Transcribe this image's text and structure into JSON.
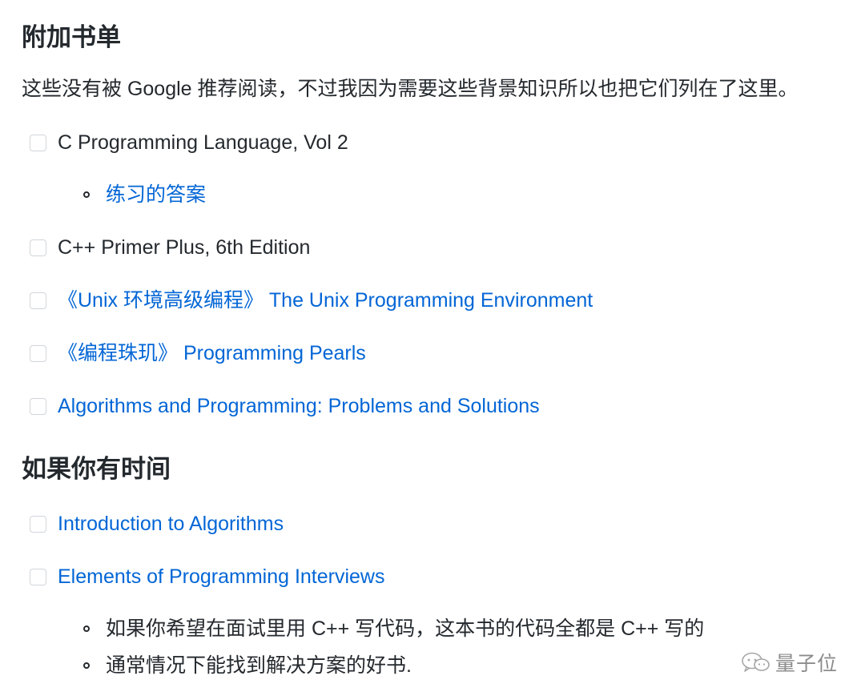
{
  "section1": {
    "title": "附加书单",
    "intro": "这些没有被 Google 推荐阅读，不过我因为需要这些背景知识所以也把它们列在了这里。",
    "items": [
      {
        "text": "C Programming Language, Vol 2",
        "checked": false,
        "subitems": [
          {
            "text": "练习的答案"
          }
        ]
      },
      {
        "text": "C++ Primer Plus, 6th Edition",
        "checked": false
      },
      {
        "text": "《Unix 环境高级编程》 The Unix Programming Environment",
        "checked": false
      },
      {
        "text": "《编程珠玑》 Programming Pearls",
        "checked": false
      },
      {
        "text": "Algorithms and Programming: Problems and Solutions",
        "checked": false
      }
    ]
  },
  "section2": {
    "title": "如果你有时间",
    "items": [
      {
        "text": "Introduction to Algorithms",
        "checked": false
      },
      {
        "text": "Elements of Programming Interviews",
        "checked": false,
        "subitems": [
          {
            "text": "如果你希望在面试里用 C++ 写代码，这本书的代码全都是 C++ 写的"
          },
          {
            "text": "通常情况下能找到解决方案的好书."
          }
        ]
      }
    ]
  },
  "watermark": {
    "text": "量子位",
    "icon": "wechat-icon"
  },
  "colors": {
    "text": "#24292e",
    "link": "#0366d6",
    "checkbox_border": "#d1d5da"
  }
}
